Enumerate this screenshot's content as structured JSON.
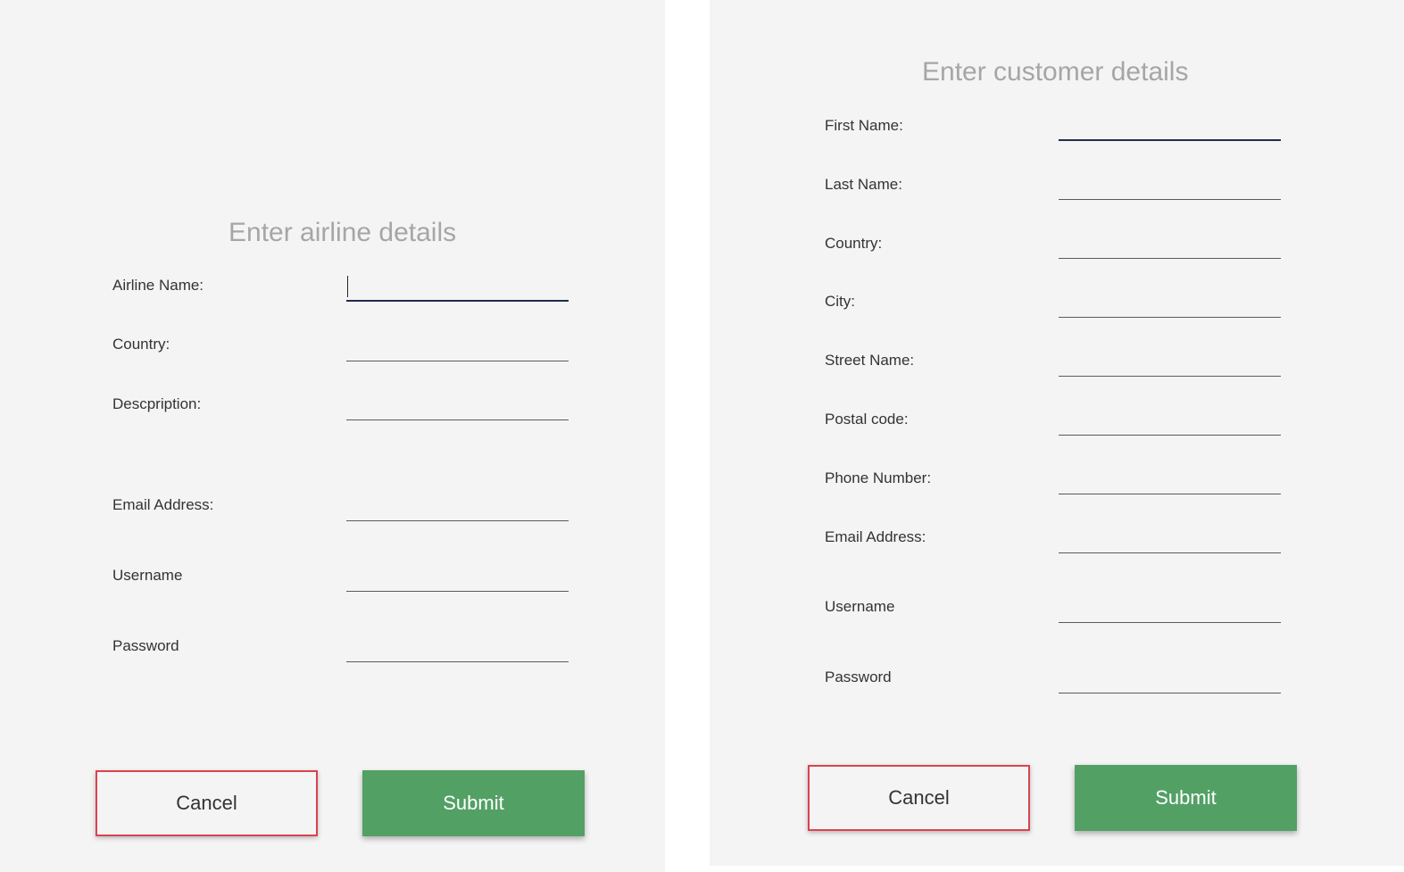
{
  "airline_form": {
    "title": "Enter airline details",
    "fields": [
      {
        "label": "Airline Name:",
        "value": ""
      },
      {
        "label": "Country:",
        "value": ""
      },
      {
        "label": "Descpription:",
        "value": ""
      },
      {
        "label": "Email Address:",
        "value": ""
      },
      {
        "label": "Username",
        "value": ""
      },
      {
        "label": "Password",
        "value": ""
      }
    ],
    "cancel_label": "Cancel",
    "submit_label": "Submit"
  },
  "customer_form": {
    "title": "Enter customer details",
    "fields": [
      {
        "label": "First Name:",
        "value": ""
      },
      {
        "label": "Last Name:",
        "value": ""
      },
      {
        "label": "Country:",
        "value": ""
      },
      {
        "label": "City:",
        "value": ""
      },
      {
        "label": "Street Name:",
        "value": ""
      },
      {
        "label": "Postal code:",
        "value": ""
      },
      {
        "label": "Phone Number:",
        "value": ""
      },
      {
        "label": "Email Address:",
        "value": ""
      },
      {
        "label": "Username",
        "value": ""
      },
      {
        "label": "Password",
        "value": ""
      }
    ],
    "cancel_label": "Cancel",
    "submit_label": "Submit"
  },
  "colors": {
    "panel_background": "#f4f4f4",
    "title_text": "#a6a6a6",
    "cancel_border": "#d9434e",
    "submit_background": "#53a065",
    "focus_underline": "#1f2d4d"
  }
}
